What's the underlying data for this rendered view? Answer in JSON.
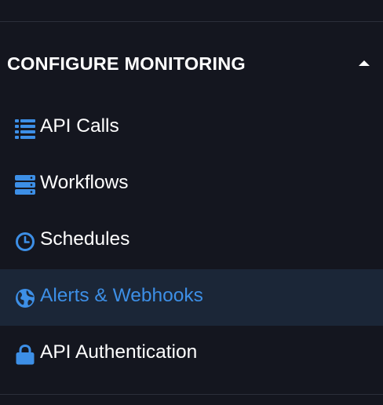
{
  "section": {
    "title": "CONFIGURE MONITORING",
    "expanded": true
  },
  "menu": {
    "items": [
      {
        "label": "API Calls",
        "icon": "list-icon",
        "active": false
      },
      {
        "label": "Workflows",
        "icon": "server-stack-icon",
        "active": false
      },
      {
        "label": "Schedules",
        "icon": "clock-icon",
        "active": false
      },
      {
        "label": "Alerts & Webhooks",
        "icon": "globe-icon",
        "active": true
      },
      {
        "label": "API Authentication",
        "icon": "lock-icon",
        "active": false
      }
    ]
  },
  "colors": {
    "background": "#14161f",
    "active_background": "#1b2637",
    "icon_blue": "#3d8fe6",
    "text": "#ffffff",
    "divider": "#2b2e3a"
  }
}
